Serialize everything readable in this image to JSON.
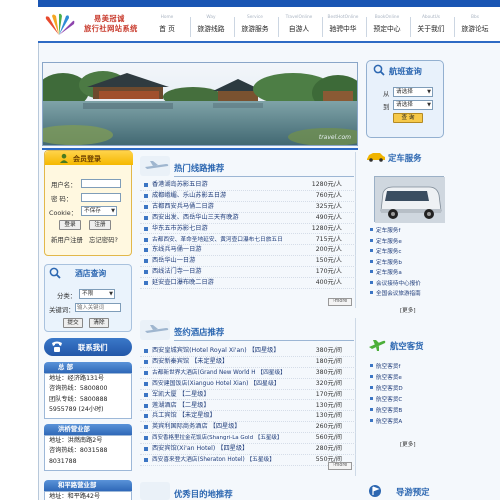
{
  "site": {
    "logo_line1": "易美冠诚",
    "logo_line2": "旅行社网站系统"
  },
  "nav": [
    {
      "en": "Home",
      "zh": "首 页"
    },
    {
      "en": "Way",
      "zh": "旅游线路"
    },
    {
      "en": "Service",
      "zh": "旅游服务"
    },
    {
      "en": "TravelOnline",
      "zh": "自游人"
    },
    {
      "en": "BestHotOnline",
      "zh": "驰骋中华"
    },
    {
      "en": "BookOnline",
      "zh": "预定中心"
    },
    {
      "en": "AboutUs",
      "zh": "关于我们"
    },
    {
      "en": "Bbs",
      "zh": "旅游论坛"
    }
  ],
  "banner": {
    "watermark": "travel.com"
  },
  "search": {
    "title": "航班查询",
    "from_label": "从",
    "to_label": "到",
    "from_value": "请选择",
    "to_value": "请选择",
    "button": "查 询"
  },
  "member": {
    "title": "会员登录",
    "user_label": "用户名：",
    "pwd_label": "密 码：",
    "cookie_label": "Cookie：",
    "cookie_value": "不保存",
    "login_btn": "登录",
    "register_btn": "注册",
    "new_user": "新用户注册",
    "forgot": "忘记密码?"
  },
  "hotel_search": {
    "title": "酒店查询",
    "category_label": "分类：",
    "category_value": "不限",
    "keyword_label": "关键词：",
    "keyword_placeholder": "输入关键词",
    "submit": "提交",
    "clear": "清除"
  },
  "contact": {
    "title": "联系我们"
  },
  "offices": [
    {
      "name": "总 部",
      "lines": [
        "地址：经济路131号",
        "咨询热线：5800800",
        "团队专线：5800888",
        "5955789 (24小时)"
      ]
    },
    {
      "name": "洪桥营业部",
      "lines": [
        "地址：洪燃南路2号",
        "咨询热线：8031588",
        "8031788"
      ]
    },
    {
      "name": "和平路营业部",
      "lines": [
        "地址：和平路42号"
      ]
    }
  ],
  "hot_routes": {
    "title": "热门线路推荐",
    "more": "more",
    "items": [
      {
        "name": "香港湖岛苏影五日游",
        "price": "1280元/人"
      },
      {
        "name": "成都峨嵋、乐山苏影五日游",
        "price": "760元/人"
      },
      {
        "name": "古都西安兵马俑二日游",
        "price": "325元/人"
      },
      {
        "name": "西安出发、西岳华山三天有晚游",
        "price": "490元/人"
      },
      {
        "name": "华东五市苏影七日游",
        "price": "1280元/人"
      },
      {
        "name": "古都西安、革命圣地延安、黄河壶口瀑布七日旅五日",
        "price": "715元/人"
      },
      {
        "name": "东线兵马俑一日游",
        "price": "200元/人"
      },
      {
        "name": "西岳华山一日游",
        "price": "150元/人"
      },
      {
        "name": "西线法门寺一日游",
        "price": "170元/人"
      },
      {
        "name": "延安壶口瀑布晚二日游",
        "price": "400元/人"
      }
    ]
  },
  "hotels": {
    "title": "签约酒店推荐",
    "more": "more",
    "items": [
      {
        "name": "西安皇城宾馆(Hotel Royal Xi'an) 【四星级】",
        "price": "380元/间"
      },
      {
        "name": "西安新秦宾馆 【未定星级】",
        "price": "180元/间"
      },
      {
        "name": "古都新世界大酒店(Grand New World H 【四星级】",
        "price": "380元/间"
      },
      {
        "name": "西安建国饭店(Xianguo Hotel Xian) 【四星级】",
        "price": "320元/间"
      },
      {
        "name": "军凯大厦 【二星级】",
        "price": "170元/间"
      },
      {
        "name": "莲湖酒店 【二星级】",
        "price": "130元/间"
      },
      {
        "name": "兵工宾馆 【未定星级】",
        "price": "130元/间"
      },
      {
        "name": "英宾利国际商务酒店 【四星级】",
        "price": "260元/间"
      },
      {
        "name": "西安香格里拉金花饭店(Shangri-La Gold 【五星级】",
        "price": "560元/间"
      },
      {
        "name": "西安宾馆(Xi'an Hotel) 【四星级】",
        "price": "280元/间"
      },
      {
        "name": "西安喜来登大酒店(Sheraton Hotel) 【五星级】",
        "price": "550元/间"
      }
    ]
  },
  "bottom_title": "优秀目的地推荐",
  "car_service": {
    "title": "定车服务",
    "items": [
      "定车服务f",
      "定车服务e",
      "定车服务c",
      "定车服务b",
      "定车服务a",
      "会议接待中心报价",
      "全国会议旅游指南"
    ],
    "more": "[更多]"
  },
  "air_service": {
    "title": "航空客货",
    "items": [
      "航空客货f",
      "航空客货e",
      "航空客货D",
      "航空客货C",
      "航空客货B",
      "航空客货A"
    ],
    "more": "[更多]"
  },
  "guide": {
    "title": "导游预定"
  },
  "colors": {
    "nav_bar": "#1a55b3",
    "accent": "#2c67b1",
    "member_gold": "#f5b800",
    "link": "#1f3c7a"
  }
}
